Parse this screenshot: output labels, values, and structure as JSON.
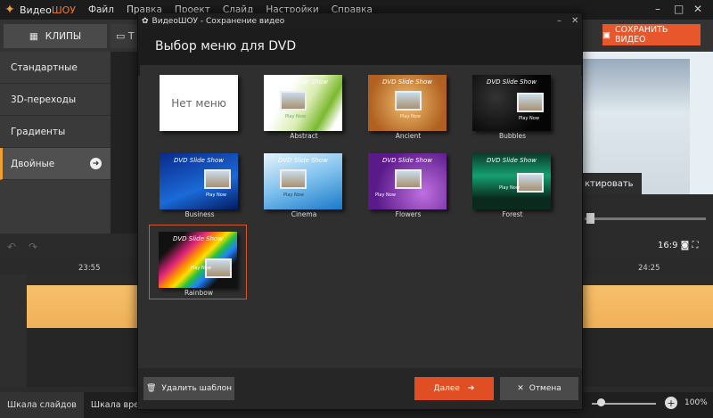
{
  "app": {
    "title_prefix": "Видео",
    "title_suffix": "ШОУ",
    "menu": [
      "Файл",
      "Правка",
      "Проект",
      "Слайд",
      "Настройки",
      "Справка"
    ]
  },
  "toolbar": {
    "tab_clips": "КЛИПЫ",
    "tab_text": "Т",
    "save_button": "СОХРАНИТЬ ВИДЕО"
  },
  "left_panel": {
    "categories": [
      "Стандартные",
      "3D-переходы",
      "Градиенты",
      "Двойные"
    ]
  },
  "preview": {
    "edit_button": "ктировать",
    "ratio": "16:9"
  },
  "timeline": {
    "times": [
      "23:55",
      "24:25"
    ]
  },
  "bottom": {
    "tab_slides": "Шкала слайдов",
    "tab_time": "Шкала времени",
    "zoom": "100%"
  },
  "dialog": {
    "title": "ВидеоШОУ - Сохранение видео",
    "header": "Выбор меню для DVD",
    "items": [
      {
        "label": "",
        "thumb_text": "Нет меню"
      },
      {
        "label": "Abstract",
        "thumb_text": "DVD Slide Show"
      },
      {
        "label": "Ancient",
        "thumb_text": "DVD Slide Show"
      },
      {
        "label": "Bubbles",
        "thumb_text": "DVD Slide Show"
      },
      {
        "label": "Business",
        "thumb_text": "DVD Slide Show"
      },
      {
        "label": "Cinema",
        "thumb_text": "DVD Slide Show"
      },
      {
        "label": "Flowers",
        "thumb_text": "DVD Slide Show"
      },
      {
        "label": "Forest",
        "thumb_text": "DVD Slide Show"
      },
      {
        "label": "Rainbow",
        "thumb_text": "DVD Slide Show"
      }
    ],
    "play_text": "Play Now",
    "delete_button": "Удалить шаблон",
    "next_button": "Далее",
    "cancel_button": "Отмена"
  },
  "colors": {
    "accent": "#e8572c",
    "selected_border": "#d25a2a"
  }
}
